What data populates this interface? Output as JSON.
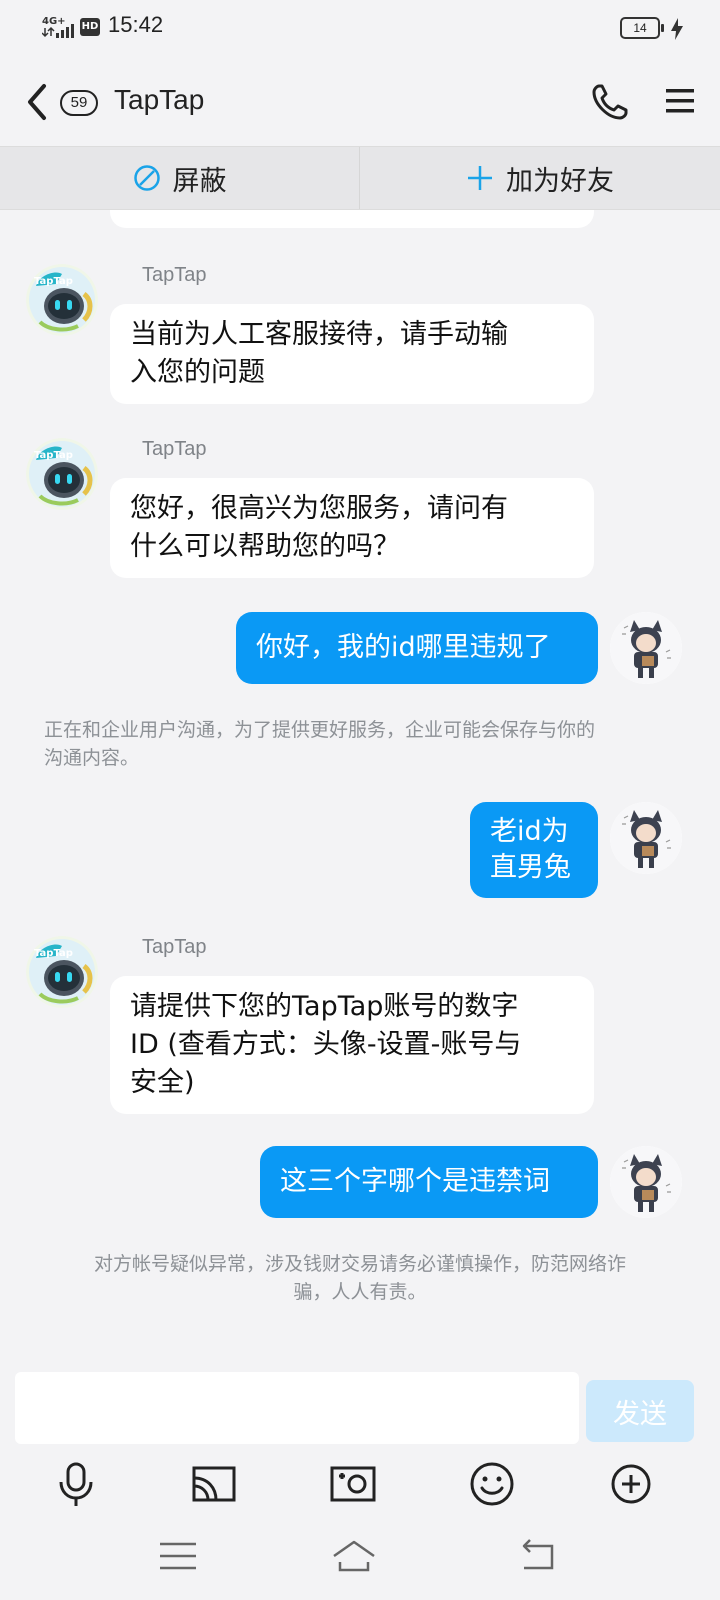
{
  "status_bar": {
    "network": "4G+",
    "hd": "HD",
    "time": "15:42",
    "battery": "14"
  },
  "header": {
    "unread_count": "59",
    "title": "TapTap"
  },
  "actions": {
    "block_label": "屏蔽",
    "add_friend_label": "加为好友"
  },
  "messages": {
    "m1": {
      "sender": "TapTap",
      "text_line1": "当前为人工客服接待，请手动输",
      "text_line2": "入您的问题"
    },
    "m2": {
      "sender": "TapTap",
      "text_line1": "您好，很高兴为您服务，请问有",
      "text_line2": "什么可以帮助您的吗？"
    },
    "m3": {
      "text": "你好，我的id哪里违规了"
    },
    "notice1_line1": "正在和企业用户沟通，为了提供更好服务，企业可能会保存与你的",
    "notice1_line2": "沟通内容。",
    "m4": {
      "text_line1": "老id为",
      "text_line2": "直男兔"
    },
    "m5": {
      "sender": "TapTap",
      "text_line1": "请提供下您的TapTap账号的数字",
      "text_line2": "ID (查看方式：头像-设置-账号与",
      "text_line3": "安全)"
    },
    "m6": {
      "text": "这三个字哪个是违禁词"
    },
    "notice2_line1": "对方帐号疑似异常，涉及钱财交易请务必谨慎操作，防范网络诈",
    "notice2_line2": "骗，人人有责。"
  },
  "input": {
    "value": "",
    "send_label": "发送"
  },
  "colors": {
    "my_bubble": "#0a99f5",
    "other_bubble": "#ffffff",
    "background": "#f3f3f5",
    "accent_icon": "#1aa3e8",
    "send_disabled": "#cce9fc"
  },
  "icons": {
    "back": "chevron-left-icon",
    "phone": "phone-icon",
    "menu": "hamburger-menu-icon",
    "block": "block-circle-icon",
    "add": "plus-icon",
    "mic": "microphone-icon",
    "cast": "screen-cast-icon",
    "photo": "camera-photo-icon",
    "emoji": "smiley-icon",
    "more": "plus-circle-icon"
  }
}
